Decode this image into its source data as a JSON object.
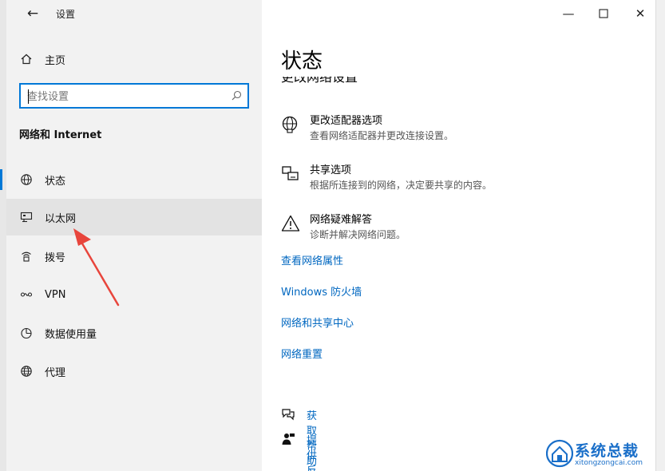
{
  "window": {
    "app_title": "设置"
  },
  "sidebar": {
    "home_label": "主页",
    "search_placeholder": "查找设置",
    "section_title": "网络和 Internet",
    "items": [
      {
        "label": "状态",
        "icon": "globe-icon",
        "active": true
      },
      {
        "label": "以太网",
        "icon": "ethernet-icon",
        "selected": true
      },
      {
        "label": "拨号",
        "icon": "dialup-icon"
      },
      {
        "label": "VPN",
        "icon": "vpn-icon"
      },
      {
        "label": "数据使用量",
        "icon": "data-usage-icon"
      },
      {
        "label": "代理",
        "icon": "proxy-globe-icon"
      }
    ]
  },
  "main": {
    "title": "状态",
    "clipped_heading": "更改网络设置",
    "options": [
      {
        "title": "更改适配器选项",
        "desc": "查看网络适配器并更改连接设置。",
        "icon": "adapter-globe-icon"
      },
      {
        "title": "共享选项",
        "desc": "根据所连接到的网络，决定要共享的内容。",
        "icon": "sharing-icon"
      },
      {
        "title": "网络疑难解答",
        "desc": "诊断并解决网络问题。",
        "icon": "warning-icon"
      }
    ],
    "links": [
      "查看网络属性",
      "Windows 防火墙",
      "网络和共享中心",
      "网络重置"
    ],
    "help": [
      {
        "label": "获取帮助",
        "icon": "help-chat-icon"
      },
      {
        "label": "提供反馈",
        "icon": "feedback-icon"
      }
    ]
  },
  "watermark": {
    "name": "系统总裁",
    "url": "xitongzongcai.com"
  },
  "colors": {
    "accent": "#0078d7",
    "link": "#0067c0",
    "annotation_arrow": "#e8453c"
  }
}
